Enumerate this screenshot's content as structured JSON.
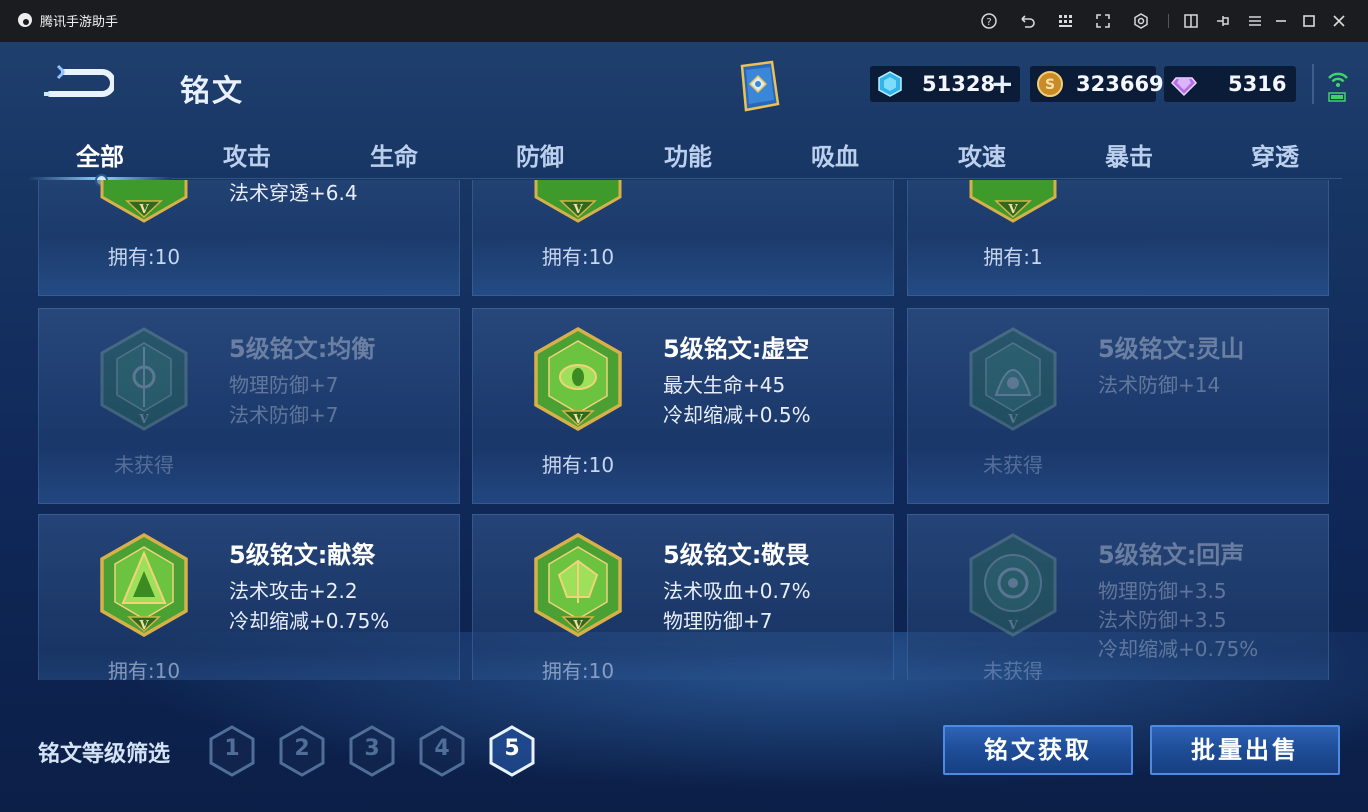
{
  "window": {
    "title": "腾讯手游助手"
  },
  "header": {
    "title": "铭文"
  },
  "currency": {
    "diamonds": "51328",
    "coins": "323669",
    "gems": "5316"
  },
  "tabs": [
    "全部",
    "攻击",
    "生命",
    "防御",
    "功能",
    "吸血",
    "攻速",
    "暴击",
    "穿透"
  ],
  "cards": [
    {
      "name": "",
      "stats": [
        "法术穿透+6.4"
      ],
      "status": "拥有:10",
      "owned": true
    },
    {
      "name": "",
      "stats": [],
      "status": "拥有:10",
      "owned": true
    },
    {
      "name": "",
      "stats": [],
      "status": "拥有:1",
      "owned": true
    },
    {
      "name": "5级铭文:均衡",
      "stats": [
        "物理防御+7",
        "法术防御+7"
      ],
      "status": "未获得",
      "owned": false
    },
    {
      "name": "5级铭文:虚空",
      "stats": [
        "最大生命+45",
        "冷却缩减+0.5%"
      ],
      "status": "拥有:10",
      "owned": true
    },
    {
      "name": "5级铭文:灵山",
      "stats": [
        "法术防御+14"
      ],
      "status": "未获得",
      "owned": false
    },
    {
      "name": "5级铭文:献祭",
      "stats": [
        "法术攻击+2.2",
        "冷却缩减+0.75%"
      ],
      "status": "拥有:10",
      "owned": true
    },
    {
      "name": "5级铭文:敬畏",
      "stats": [
        "法术吸血+0.7%",
        "物理防御+7"
      ],
      "status": "拥有:10",
      "owned": true
    },
    {
      "name": "5级铭文:回声",
      "stats": [
        "物理防御+3.5",
        "法术防御+3.5",
        "冷却缩减+0.75%"
      ],
      "status": "未获得",
      "owned": false
    }
  ],
  "emblem_level_mark": "V",
  "filter": {
    "label": "铭文等级筛选",
    "levels": [
      "1",
      "2",
      "3",
      "4",
      "5"
    ],
    "selected": "5"
  },
  "buttons": {
    "obtain": "铭文获取",
    "sell": "批量出售"
  },
  "colors": {
    "emblem_green": "#3f9a2c",
    "emblem_gold": "#d8b04a",
    "accent_blue": "#4d8ae0"
  }
}
